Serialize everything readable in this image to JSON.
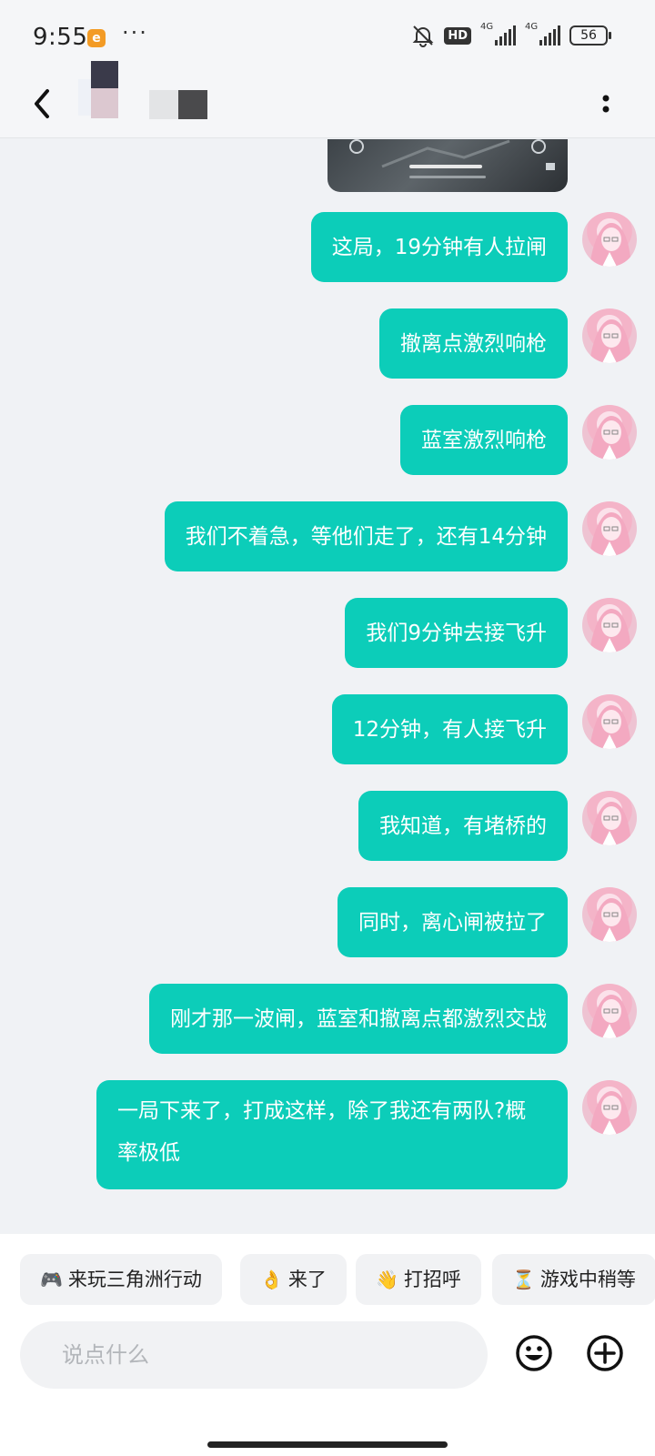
{
  "status_bar": {
    "time": "9:55",
    "app_badge": "e",
    "overflow_dots": "···",
    "hd_label": "HD",
    "net1": "4G",
    "net2": "4G",
    "battery": "56"
  },
  "header": {
    "back_icon": "chevron-left-icon",
    "more_icon": "vertical-dots-icon"
  },
  "messages": [
    {
      "text": "这局，19分钟有人拉闸"
    },
    {
      "text": "撤离点激烈响枪"
    },
    {
      "text": "蓝室激烈响枪"
    },
    {
      "text": "我们不着急，等他们走了，还有14分钟"
    },
    {
      "text": "我们9分钟去接飞升"
    },
    {
      "text": "12分钟，有人接飞升"
    },
    {
      "text": "我知道，有堵桥的"
    },
    {
      "text": "同时，离心闸被拉了"
    },
    {
      "text": "刚才那一波闸，蓝室和撤离点都激烈交战"
    },
    {
      "text": "一局下来了，打成这样，除了我还有两队?概率极低"
    }
  ],
  "quick_replies": [
    {
      "icon": "🎮",
      "label": "来玩三角洲行动"
    },
    {
      "icon": "👌",
      "label": "来了"
    },
    {
      "icon": "👋",
      "label": "打招呼"
    },
    {
      "icon": "⏳",
      "label": "游戏中稍等"
    }
  ],
  "composer": {
    "placeholder": "说点什么",
    "emoji_icon": "smiley-icon",
    "plus_icon": "plus-circle-icon"
  },
  "colors": {
    "bubble": "#0ccdb9",
    "background": "#f0f2f5"
  }
}
